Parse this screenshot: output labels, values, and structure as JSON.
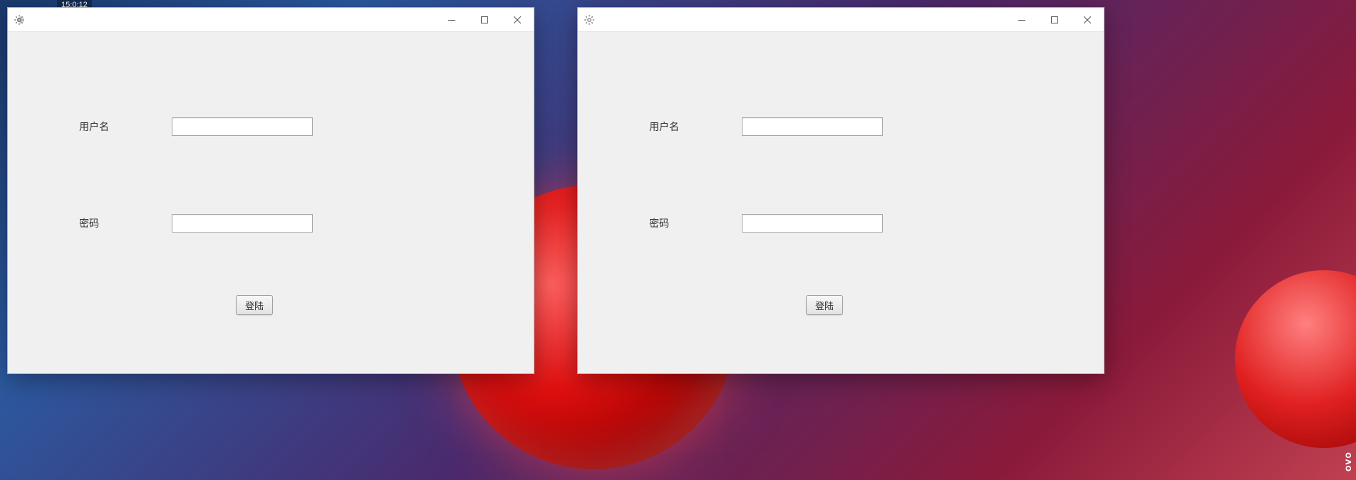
{
  "desktop": {
    "taskbar_hint": "15:0:12",
    "brand_edge": "ovo"
  },
  "windows": [
    {
      "icon": "gear-icon",
      "form": {
        "username_label": "用户名",
        "username_value": "",
        "password_label": "密码",
        "password_value": "",
        "login_label": "登陆"
      }
    },
    {
      "icon": "gear-icon",
      "form": {
        "username_label": "用户名",
        "username_value": "",
        "password_label": "密码",
        "password_value": "",
        "login_label": "登陆"
      }
    }
  ]
}
